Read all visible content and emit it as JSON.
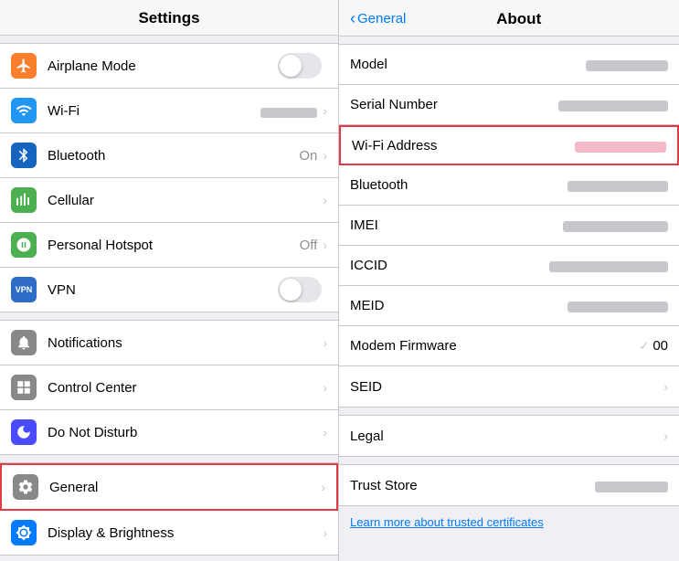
{
  "left": {
    "header": "Settings",
    "groups": [
      {
        "items": [
          {
            "id": "airplane-mode",
            "label": "Airplane Mode",
            "icon": "airplane",
            "control": "toggle-off"
          },
          {
            "id": "wifi",
            "label": "Wi-Fi",
            "icon": "wifi",
            "value": "████████",
            "control": "chevron"
          },
          {
            "id": "bluetooth",
            "label": "Bluetooth",
            "icon": "bluetooth",
            "value": "On",
            "control": "chevron"
          },
          {
            "id": "cellular",
            "label": "Cellular",
            "icon": "cellular",
            "control": "chevron"
          },
          {
            "id": "hotspot",
            "label": "Personal Hotspot",
            "icon": "hotspot",
            "value": "Off",
            "control": "chevron"
          },
          {
            "id": "vpn",
            "label": "VPN",
            "icon": "vpn",
            "control": "toggle-off"
          }
        ]
      },
      {
        "items": [
          {
            "id": "notifications",
            "label": "Notifications",
            "icon": "notifications",
            "control": "chevron"
          },
          {
            "id": "control-center",
            "label": "Control Center",
            "icon": "control",
            "control": "chevron"
          },
          {
            "id": "do-not-disturb",
            "label": "Do Not Disturb",
            "icon": "dnd",
            "control": "chevron"
          }
        ]
      },
      {
        "items": [
          {
            "id": "general",
            "label": "General",
            "icon": "general",
            "control": "chevron",
            "highlighted": true
          },
          {
            "id": "display",
            "label": "Display & Brightness",
            "icon": "display",
            "control": "chevron"
          }
        ]
      }
    ]
  },
  "right": {
    "back_label": "General",
    "title": "About",
    "rows": [
      {
        "id": "model",
        "label": "Model",
        "value_type": "blurred",
        "value_width": 90,
        "highlighted": false
      },
      {
        "id": "serial-number",
        "label": "Serial Number",
        "value_type": "blurred",
        "value_width": 120,
        "highlighted": false
      },
      {
        "id": "wifi-address",
        "label": "Wi-Fi Address",
        "value_type": "blurred-pink",
        "value_width": 100,
        "highlighted": true
      },
      {
        "id": "bluetooth",
        "label": "Bluetooth",
        "value_type": "blurred",
        "value_width": 110,
        "highlighted": false
      },
      {
        "id": "imei",
        "label": "IMEI",
        "value_type": "blurred",
        "value_width": 115,
        "highlighted": false
      },
      {
        "id": "iccid",
        "label": "ICCID",
        "value_type": "blurred",
        "value_width": 130,
        "highlighted": false
      },
      {
        "id": "meid",
        "label": "MEID",
        "value_type": "blurred",
        "value_width": 110,
        "highlighted": false
      },
      {
        "id": "modem-firmware",
        "label": "Modem Firmware",
        "value_text": "00",
        "value_type": "text",
        "highlighted": false
      },
      {
        "id": "seid",
        "label": "SEID",
        "value_type": "chevron-only",
        "highlighted": false
      }
    ],
    "second_group": [
      {
        "id": "legal",
        "label": "Legal",
        "value_type": "chevron-only",
        "highlighted": false
      }
    ],
    "third_group": [
      {
        "id": "trust-store",
        "label": "Trust Store",
        "value_type": "blurred-small",
        "value_width": 80,
        "highlighted": false
      }
    ],
    "learn_more": "Learn more about trusted certificates"
  }
}
